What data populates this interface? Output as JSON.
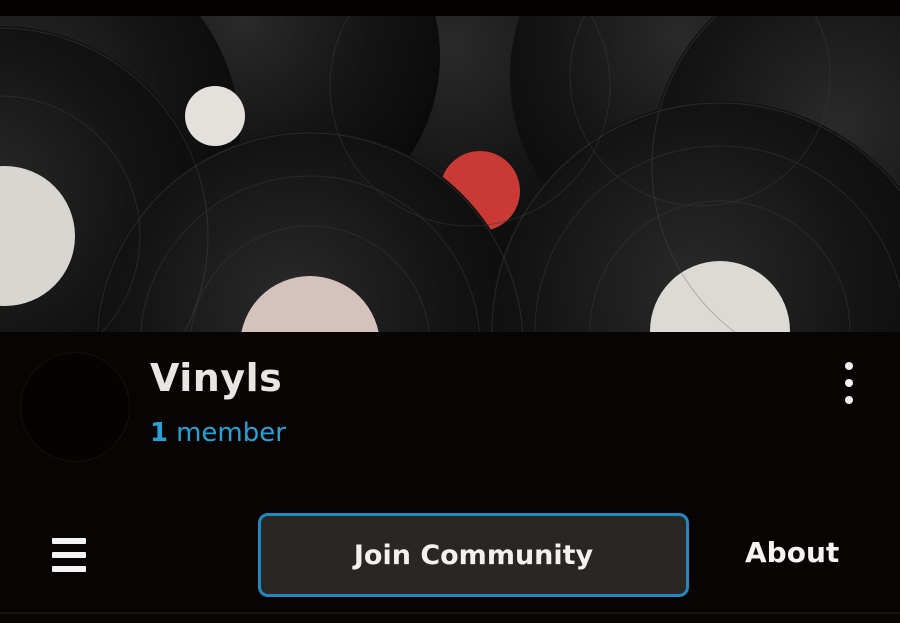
{
  "community": {
    "name": "Vinyls",
    "member_count": "1",
    "member_label": "member"
  },
  "banner": {
    "image_subject": "vinyl records"
  },
  "icons": {
    "more": "more-vertical-icon",
    "menu": "hamburger-menu-icon"
  },
  "actions": {
    "join_label": "Join Community",
    "about_label": "About"
  },
  "colors": {
    "background": "#080403",
    "accent": "#23a3d8",
    "button_border": "#1f8ac2",
    "button_fill": "#2a2624",
    "text_primary": "#e9e5e2"
  }
}
